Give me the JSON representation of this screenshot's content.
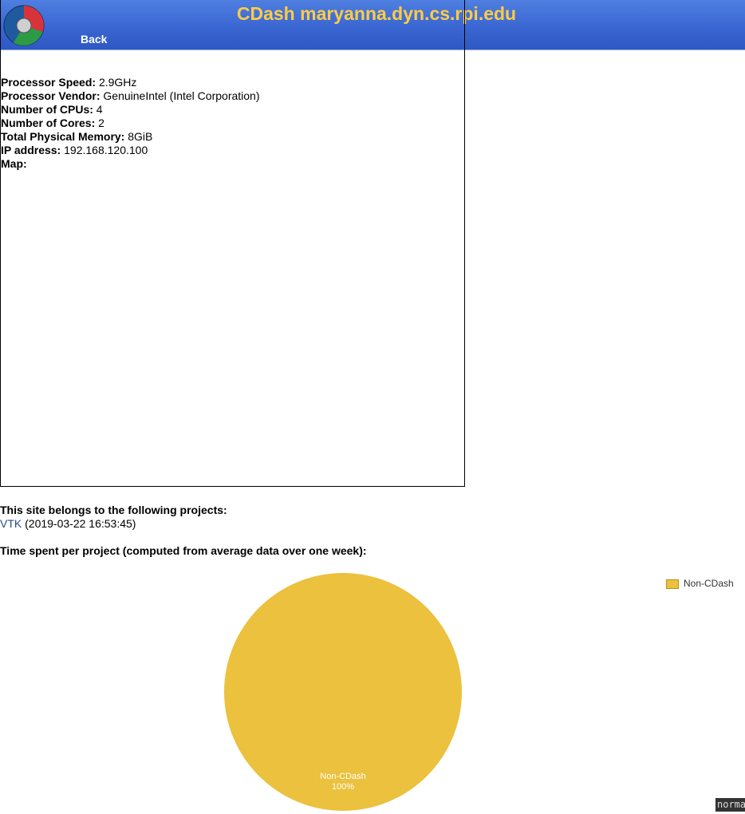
{
  "header": {
    "title": "CDash maryanna.dyn.cs.rpi.edu",
    "back_label": "Back"
  },
  "site_info": [
    {
      "label": "Processor Speed:",
      "value": "2.9GHz"
    },
    {
      "label": "Processor Vendor:",
      "value": "GenuineIntel (Intel Corporation)"
    },
    {
      "label": "Number of CPUs:",
      "value": "4"
    },
    {
      "label": "Number of Cores:",
      "value": "2"
    },
    {
      "label": "Total Physical Memory:",
      "value": "8GiB"
    },
    {
      "label": "IP address:",
      "value": "192.168.120.100"
    },
    {
      "label": "Map:",
      "value": ""
    }
  ],
  "projects": {
    "heading": "This site belongs to the following projects:",
    "items": [
      {
        "name": "VTK",
        "date": "(2019-03-22 16:53:45)"
      }
    ]
  },
  "time_section": {
    "heading": "Time spent per project (computed from average data over one week):"
  },
  "chart_data": {
    "type": "pie",
    "slices": [
      {
        "label": "Non-CDash",
        "value": 100,
        "percent_label": "100%",
        "color": "#ebc13e"
      }
    ],
    "legend": [
      {
        "name": "Non-CDash",
        "color": "#ebc13e"
      }
    ],
    "legend_position": "top-right"
  },
  "status_badge": "norma",
  "colors": {
    "header_bg": "#3a66d2",
    "title_color": "#ffcc44",
    "link_color": "#2a4a8a"
  }
}
